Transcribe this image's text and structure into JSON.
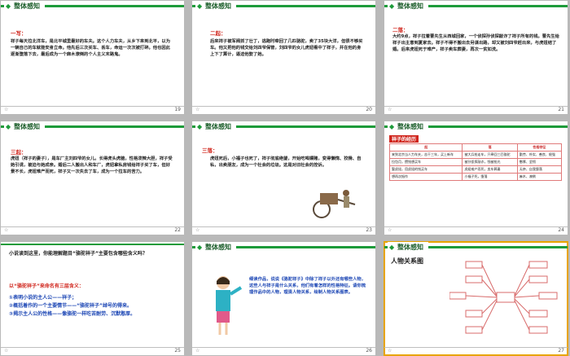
{
  "slides": [
    {
      "num": "19",
      "title": "整体感知",
      "section": "一写：",
      "text": "祥子每天拉北洋车，是北平城里最好的车夫。这个人力车夫，从乡下来到北平，以为一辆自己的车就能安身立命。他先后三次买车、丢车，命运一次次被打碎。他也因此逐渐堕落下去，最后成为一个麻木潦倒的个人主义末路鬼。"
    },
    {
      "num": "20",
      "title": "整体感知",
      "section": "二起：",
      "text": "后来祥子被军阀抓了壮丁，逃跑时牵回了几匹骆驼，卖了35块大洋，但很不够买车。他又把他的钱交给刘四爷保管，刘四爷的女儿虎妞看中了祥子，并在他的身上下了算计，逼迫他娶了她。"
    },
    {
      "num": "21",
      "title": "整体感知",
      "section": "二落：",
      "text": "大约9点，祥子拉着曹先生从西城回家，一个侦探孙侦探敲诈了祥子所有的钱。曹先生给祥子出主意到夏家去。祥子不得不搬出去另谋出路，却又被刘四爷赶出来，与虎妞结了婚。后来虎妞死于难产，祥子卖车葬妻，再次一贫如洗。"
    },
    {
      "num": "22",
      "title": "整体感知",
      "section": "三起：",
      "text": "虎妞（祥子的妻子），是车厂主刘四爷的女儿。长得虎头虎脑，性格泼辣大胆，祥子受她引诱，被迫与她成亲。婚后二人搬出人和车厂，虎妞拿私房钱给祥子买了车，但好景不长，虎妞难产而死，祥子又一次失去了车，成为一个拉车的苦力。"
    },
    {
      "num": "23",
      "title": "整体感知",
      "section": "三落：",
      "text": "虎妞死后，小福子也死了，祥子彻底绝望，开始吃喝嫖赌，变得懒惰、狡猾、自私，出卖朋友，成为一个社会的垃圾。这是对旧社会的控诉。"
    },
    {
      "num": "24",
      "title": "整体感知",
      "subtitle": "祥子的经历",
      "headers": [
        "起",
        "落",
        "性格特征"
      ],
      "rows": [
        [
          "来到北京当人力车夫，苦干三年，买上新车",
          "被大兵抢走车，只牵回三匹骆驼",
          "勤劳、朴实、善良、倔强"
        ],
        [
          "拉包月，攒钱想买车",
          "被孙侦探敲诈，钱被抢光",
          "憨厚、坚韧"
        ],
        [
          "娶虎妞，用虎妞的钱买车",
          "虎妞难产而死，卖车葬妻",
          "无奈、自我堕落"
        ],
        [
          "想再次振作",
          "小福子死，堕落",
          "麻木、潦倒"
        ]
      ]
    },
    {
      "num": "25",
      "title": "小说读到这里，你能理解题目“骆驼祥子”主要包含哪些含义吗？",
      "lead": "以“骆驼祥子”来命名有三层含义：",
      "items": [
        "①表明小说的主人公——祥子；",
        "②概括着作的一个主要情节——“骆驼祥子”绰号的得来。",
        "③揭示主人公的性格——像骆驼一样吃苦耐劳、沉默憨厚。"
      ]
    },
    {
      "num": "26",
      "title": "整体感知",
      "text": "细读作品，说说《骆驼祥子》中除了祥子以外还有哪些人物，这些人与祥子是什么关系，他们有着怎样的性格特征。请你梳理作品中的人物，理清人物关系，绘制人物关系图表。"
    },
    {
      "num": "27",
      "title": "整体感知",
      "subtitle": "人物关系图"
    }
  ],
  "ui": {
    "accent": "#1d9b3a",
    "selected_border": "#e8a400",
    "star": "☆"
  }
}
